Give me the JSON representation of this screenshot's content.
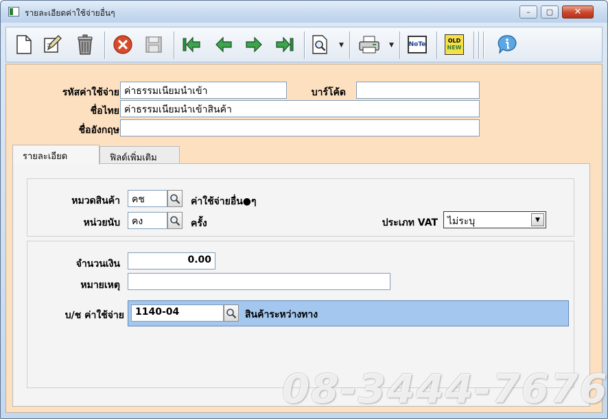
{
  "window": {
    "title": "รายละเอียดค่าใช้จ่ายอื่นๆ",
    "minimize_label": "–",
    "maximize_label": "▢",
    "close_label": "✕"
  },
  "toolbar": {
    "buttons": [
      "new-icon",
      "edit-icon",
      "delete-icon",
      "cancel-icon",
      "save-icon",
      "first-record-icon",
      "previous-record-icon",
      "next-record-icon",
      "last-record-icon",
      "search-icon",
      "print-icon",
      "note-icon",
      "old-new-icon",
      "info-icon"
    ],
    "note_text": "NoTe",
    "old_text": "OLD",
    "new_text": "NEW",
    "dropdown_glyph": "▼"
  },
  "header": {
    "code_label": "รหัสค่าใช้จ่าย",
    "code_value": "ค่าธรรมเนียมนำเข้า",
    "barcode_label": "บาร์โค้ด",
    "barcode_value": "",
    "thai_name_label": "ชื่อไทย",
    "thai_name_value": "ค่าธรรมเนียมนำเข้าสินค้า",
    "english_name_label": "ชื่ออังกฤษ",
    "english_name_value": ""
  },
  "tabs": [
    {
      "label": "รายละเอียด",
      "active": true
    },
    {
      "label": "ฟิลด์เพิ่มเติม",
      "active": false
    }
  ],
  "details": {
    "category_label": "หมวดสินค้า",
    "category_code": "คช",
    "category_desc": "ค่าใช้จ่ายอื่น●ๆ",
    "unit_label": "หน่วยนับ",
    "unit_code": "คง",
    "unit_desc": "ครั้ง",
    "vat_type_label": "ประเภท VAT",
    "vat_type_value": "ไม่ระบุ",
    "amount_label": "จำนวนเงิน",
    "amount_value": "0.00",
    "remark_label": "หมายเหตุ",
    "remark_value": "",
    "account_label": "บ/ช ค่าใช้จ่าย",
    "account_code": "1140-04",
    "account_desc": "สินค้าระหว่างทาง"
  },
  "watermark": "08-3444-7676",
  "colors": {
    "client_bg": "#fde0bf",
    "account_strip": "#a4c7ef",
    "close_button": "#c9452a"
  }
}
